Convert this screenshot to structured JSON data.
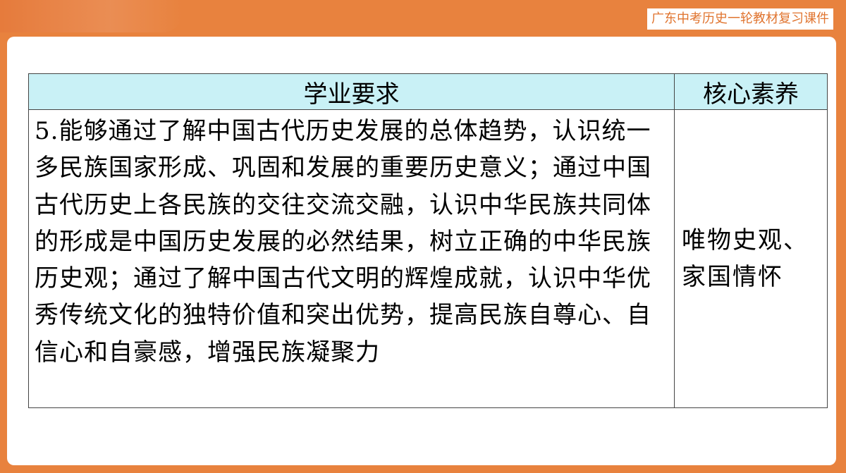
{
  "header": {
    "course_tag": "广东中考历史一轮教材复习课件"
  },
  "table": {
    "columns": [
      "学业要求",
      "核心素养"
    ],
    "rows": [
      {
        "requirement": "5.能够通过了解中国古代历史发展的总体趋势，认识统一多民族国家形成、巩固和发展的重要历史意义；通过中国古代历史上各民族的交往交流交融，认识中华民族共同体的形成是中国历史发展的必然结果，树立正确的中华民族历史观；通过了解中国古代文明的辉煌成就，认识中华优秀传统文化的独特价值和突出优势，提高民族自尊心、自信心和自豪感，增强民族凝聚力",
        "literacy": [
          "唯物史观、",
          "家国情怀"
        ]
      }
    ]
  },
  "colors": {
    "background": "#E8823E",
    "header_fill": "#C9F1F6",
    "tag_text": "#E0742F"
  }
}
